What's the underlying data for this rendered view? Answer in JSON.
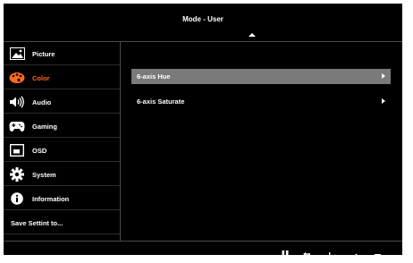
{
  "header": {
    "title": "Mode - User"
  },
  "sidebar": {
    "items": [
      {
        "label": "Picture",
        "icon": "picture-icon"
      },
      {
        "label": "Color",
        "icon": "palette-icon",
        "active": true
      },
      {
        "label": "Audio",
        "icon": "speaker-icon"
      },
      {
        "label": "Gaming",
        "icon": "gamepad-icon"
      },
      {
        "label": "OSD",
        "icon": "osd-icon"
      },
      {
        "label": "System",
        "icon": "gear-icon"
      },
      {
        "label": "Information",
        "icon": "info-icon"
      },
      {
        "label": "Save Settint to..."
      }
    ]
  },
  "main": {
    "rows": [
      {
        "label": "6-axis Hue",
        "selected": true
      },
      {
        "label": "6-axis Saturate",
        "selected": false
      }
    ]
  },
  "footer": {
    "controls": [
      "pause-icon",
      "back-icon",
      "enter-icon",
      "up-icon",
      "down-icon"
    ]
  },
  "colors": {
    "accent": "#ff6a1e",
    "selection": "#7a7a7a",
    "background": "#000000"
  }
}
